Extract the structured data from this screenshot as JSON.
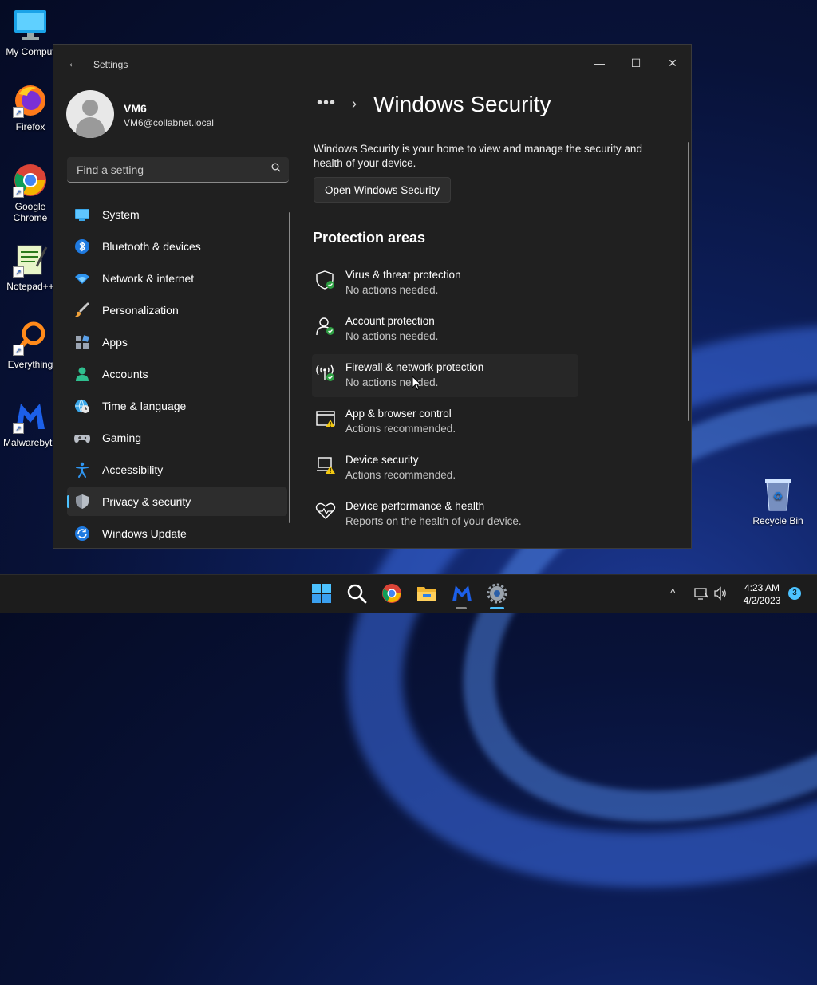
{
  "desktop": {
    "icons": [
      {
        "label": "My Comput"
      },
      {
        "label": "Firefox"
      },
      {
        "label": "Google Chrome"
      },
      {
        "label": "Notepad++"
      },
      {
        "label": "Everything"
      },
      {
        "label": "Malwarebyte"
      },
      {
        "label": "Recycle Bin"
      }
    ]
  },
  "window": {
    "title": "Settings",
    "back_glyph": "←",
    "min_glyph": "—",
    "max_glyph": "☐",
    "close_glyph": "✕"
  },
  "profile": {
    "name": "VM6",
    "email": "VM6@collabnet.local"
  },
  "search": {
    "placeholder": "Find a setting"
  },
  "nav": [
    {
      "label": "System",
      "icon": "monitor-icon"
    },
    {
      "label": "Bluetooth & devices",
      "icon": "bluetooth-icon"
    },
    {
      "label": "Network & internet",
      "icon": "wifi-icon"
    },
    {
      "label": "Personalization",
      "icon": "paintbrush-icon"
    },
    {
      "label": "Apps",
      "icon": "apps-icon"
    },
    {
      "label": "Accounts",
      "icon": "person-icon"
    },
    {
      "label": "Time & language",
      "icon": "globe-clock-icon"
    },
    {
      "label": "Gaming",
      "icon": "gamepad-icon"
    },
    {
      "label": "Accessibility",
      "icon": "accessibility-icon"
    },
    {
      "label": "Privacy & security",
      "icon": "shield-icon",
      "active": true
    },
    {
      "label": "Windows Update",
      "icon": "update-icon"
    }
  ],
  "content": {
    "breadcrumb_dots": "•••",
    "breadcrumb_chevron": "›",
    "title": "Windows Security",
    "description": "Windows Security is your home to view and manage the security and health of your device.",
    "open_button": "Open Windows Security",
    "section": "Protection areas",
    "areas": [
      {
        "title": "Virus & threat protection",
        "status": "No actions needed.",
        "icon": "virus-shield-icon",
        "state": "ok"
      },
      {
        "title": "Account protection",
        "status": "No actions needed.",
        "icon": "account-protection-icon",
        "state": "ok"
      },
      {
        "title": "Firewall & network protection",
        "status": "No actions needed.",
        "icon": "firewall-icon",
        "state": "ok"
      },
      {
        "title": "App & browser control",
        "status": "Actions recommended.",
        "icon": "app-browser-icon",
        "state": "warn"
      },
      {
        "title": "Device security",
        "status": "Actions recommended.",
        "icon": "device-security-icon",
        "state": "warn"
      },
      {
        "title": "Device performance & health",
        "status": "Reports on the health of your device.",
        "icon": "heart-icon",
        "state": "none"
      }
    ]
  },
  "taskbar": {
    "apps": [
      "start-icon",
      "search-icon",
      "chrome-icon",
      "file-explorer-icon",
      "malwarebytes-icon",
      "settings-icon"
    ],
    "tray_chevron": "^",
    "time": "4:23 AM",
    "date": "4/2/2023",
    "notifications": "3"
  },
  "colors": {
    "accent": "#4cc2ff",
    "ok": "#2ea043",
    "warn": "#f2c811",
    "window_bg": "#202020"
  }
}
